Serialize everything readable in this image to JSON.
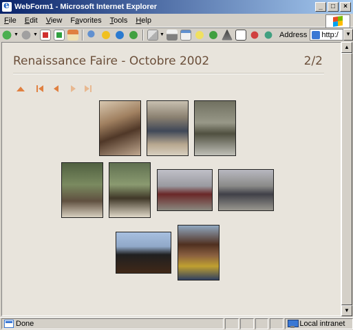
{
  "window": {
    "title": "WebForm1 - Microsoft Internet Explorer"
  },
  "menu": {
    "items": [
      {
        "label": "File",
        "accel": "F"
      },
      {
        "label": "Edit",
        "accel": "E"
      },
      {
        "label": "View",
        "accel": "V"
      },
      {
        "label": "Favorites",
        "accel": "a"
      },
      {
        "label": "Tools",
        "accel": "T"
      },
      {
        "label": "Help",
        "accel": "H"
      }
    ]
  },
  "toolbar": {
    "icons": [
      "back-icon",
      "forward-icon",
      "stop-icon",
      "refresh-icon",
      "home-icon",
      "search-icon",
      "favorites-icon",
      "media-icon",
      "history-icon",
      "mail-icon",
      "print-icon",
      "edit-icon",
      "discuss-icon",
      "messenger-icon",
      "research-icon",
      "msn-icon",
      "extra-icon",
      "extra2-icon"
    ],
    "address_label": "Address",
    "address_value": "http:/"
  },
  "content": {
    "title": "Renaissance Faire - Octobre 2002",
    "page_counter": "2/2",
    "nav": [
      "up-arrow-icon",
      "first-icon",
      "prev-icon",
      "next-icon",
      "last-icon"
    ],
    "nav_disabled": [
      false,
      false,
      false,
      true,
      true
    ],
    "accent": "#e08040",
    "photos": [
      {
        "name": "photo-1",
        "colors": [
          "#c8b8a0",
          "#604030",
          "#a08060"
        ]
      },
      {
        "name": "photo-2",
        "colors": [
          "#b0a090",
          "#404050",
          "#806850"
        ]
      },
      {
        "name": "photo-3",
        "colors": [
          "#8a8a7a",
          "#505040",
          "#b0b0a8"
        ]
      },
      {
        "name": "photo-4",
        "colors": [
          "#6a7a50",
          "#c8c0b0",
          "#403828"
        ]
      },
      {
        "name": "photo-5",
        "colors": [
          "#708060",
          "#d8d0c0",
          "#303020"
        ]
      },
      {
        "name": "photo-6",
        "colors": [
          "#a8a8b0",
          "#602020",
          "#707068"
        ]
      },
      {
        "name": "photo-7",
        "colors": [
          "#b0b0b8",
          "#505048",
          "#787870"
        ]
      },
      {
        "name": "photo-8",
        "colors": [
          "#9ab0d8",
          "#1a1a1a",
          "#705030"
        ]
      },
      {
        "name": "photo-9",
        "colors": [
          "#90a8c0",
          "#402010",
          "#c0a030"
        ]
      }
    ]
  },
  "status": {
    "text": "Done",
    "zone": "Local intranet"
  }
}
